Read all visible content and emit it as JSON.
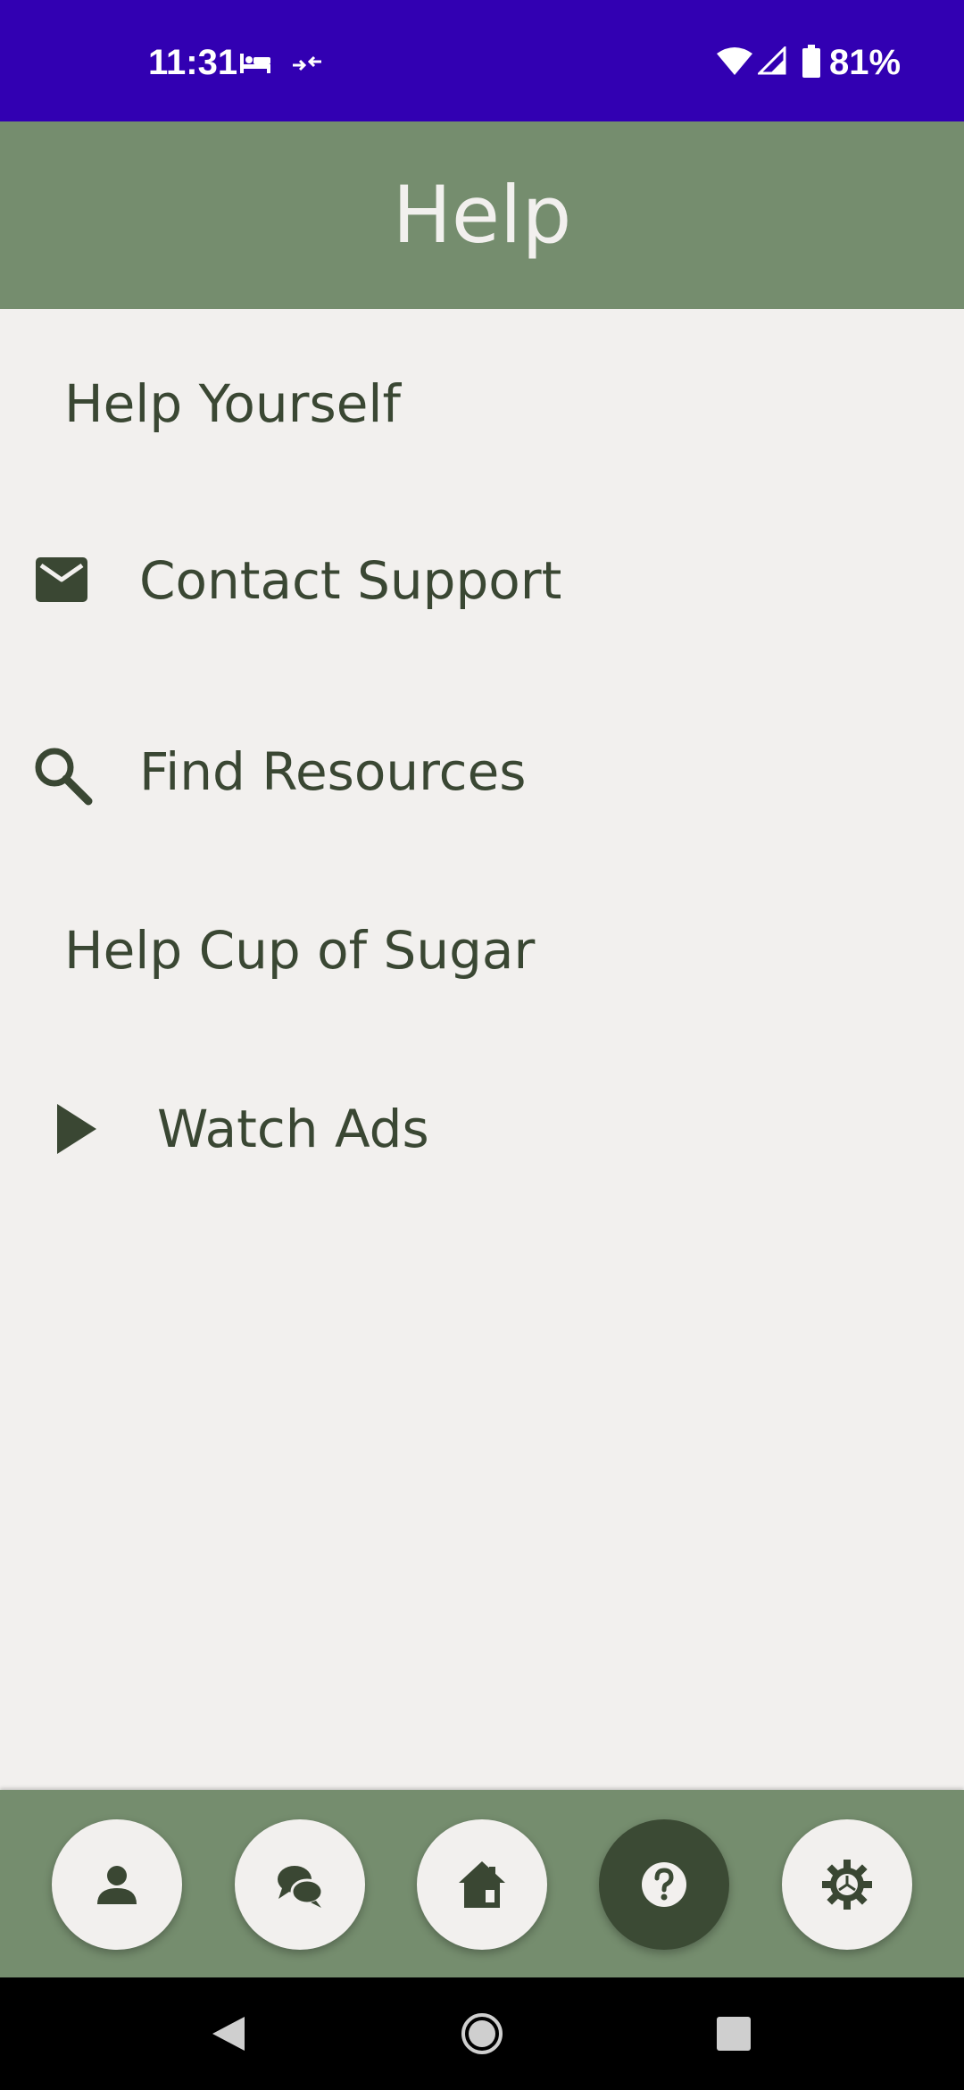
{
  "status_bar": {
    "time": "11:31",
    "battery": "81%",
    "icons": [
      "bed-icon",
      "data-saver-icon",
      "wifi-icon",
      "cell-signal-icon",
      "battery-icon"
    ],
    "background_color": "#3200b2"
  },
  "app_bar": {
    "title": "Help",
    "background_color": "#758d6e"
  },
  "menu": {
    "items": [
      {
        "label": "Help Yourself",
        "icon": null
      },
      {
        "label": "Contact Support",
        "icon": "mail-icon"
      },
      {
        "label": "Find Resources",
        "icon": "search-icon"
      },
      {
        "label": "Help Cup of Sugar",
        "icon": null
      },
      {
        "label": "Watch Ads",
        "icon": "play-icon"
      }
    ]
  },
  "bottom_nav": {
    "items": [
      {
        "icon": "person-icon",
        "active": false
      },
      {
        "icon": "chat-bubbles-icon",
        "active": false
      },
      {
        "icon": "home-icon",
        "active": false
      },
      {
        "icon": "help-icon",
        "active": true
      },
      {
        "icon": "settings-gear-icon",
        "active": false
      }
    ],
    "active_color": "#3b4a34"
  },
  "system_nav": {
    "icons": [
      "back-icon",
      "home-circle-icon",
      "recents-icon"
    ]
  },
  "colors": {
    "text_dark_green": "#3a4733",
    "background": "#f2f0ee",
    "accent_green": "#758d6e"
  }
}
